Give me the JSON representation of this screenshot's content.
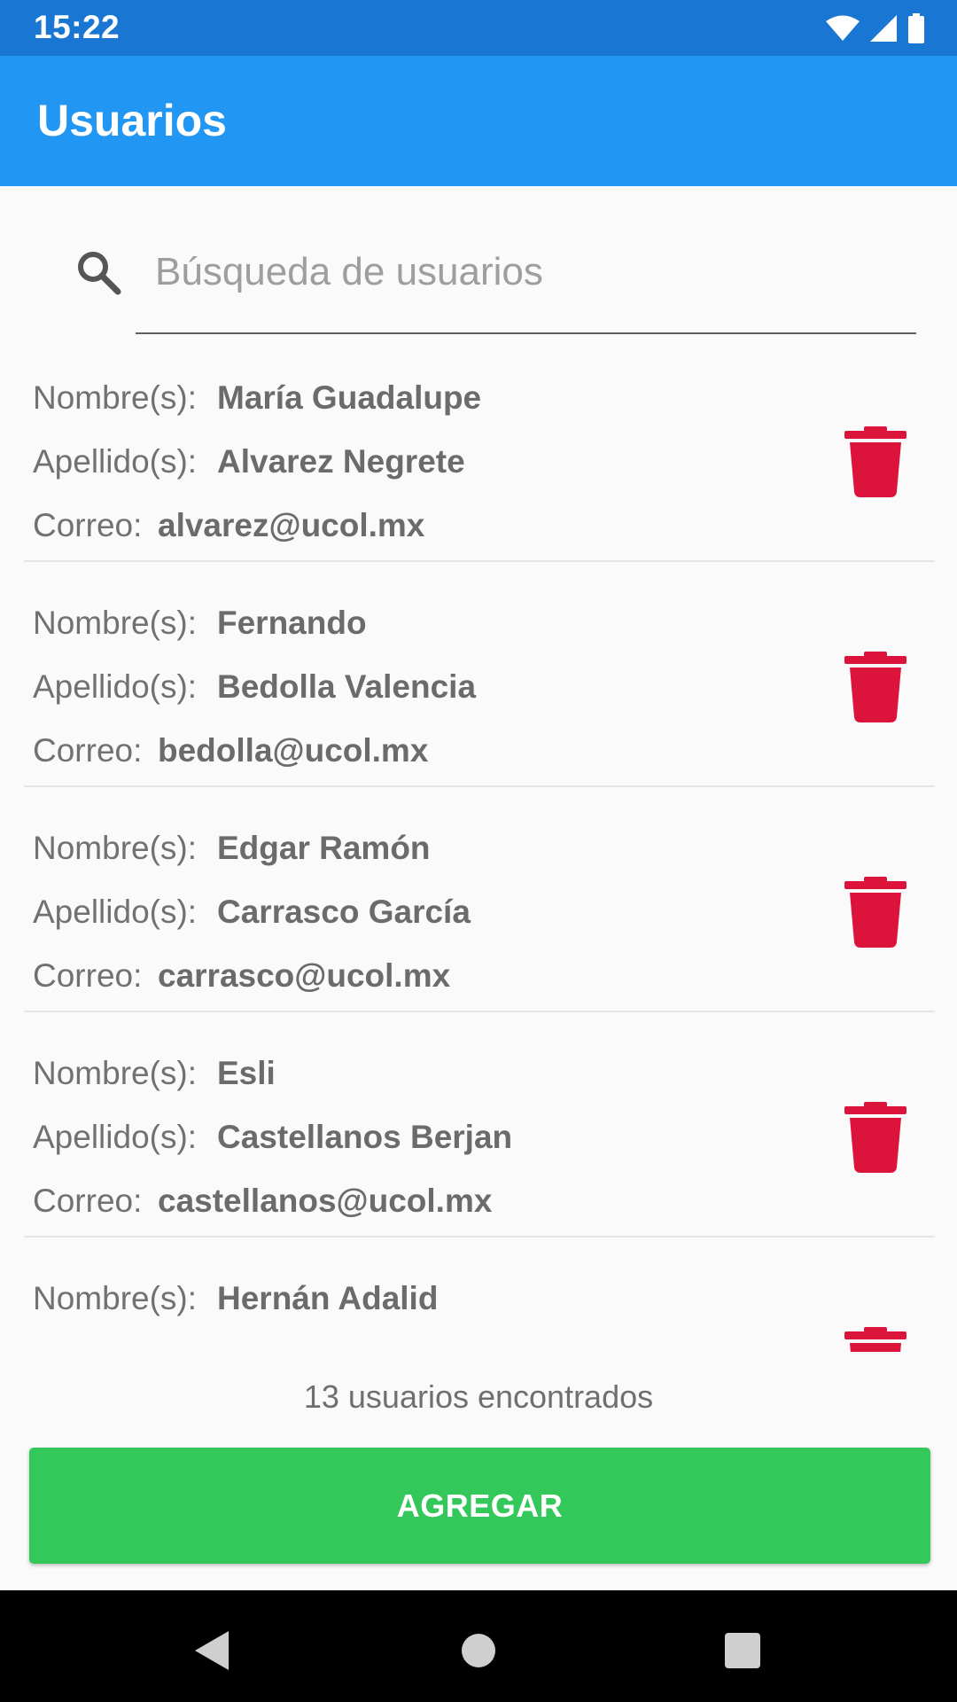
{
  "status_bar": {
    "time": "15:22"
  },
  "app_bar": {
    "title": "Usuarios"
  },
  "search": {
    "placeholder": "Búsqueda de usuarios",
    "value": ""
  },
  "labels": {
    "name": "Nombre(s):",
    "surname": "Apellido(s):",
    "email": "Correo:"
  },
  "users": [
    {
      "name": "María Guadalupe",
      "surname": "Alvarez Negrete",
      "email": "alvarez@ucol.mx"
    },
    {
      "name": "Fernando",
      "surname": "Bedolla Valencia",
      "email": "bedolla@ucol.mx"
    },
    {
      "name": "Edgar Ramón",
      "surname": "Carrasco García",
      "email": "carrasco@ucol.mx"
    },
    {
      "name": "Esli",
      "surname": "Castellanos Berjan",
      "email": "castellanos@ucol.mx"
    },
    {
      "name": "Hernán Adalid",
      "surname": "",
      "email": ""
    }
  ],
  "footer": {
    "results_text": "13 usuarios encontrados",
    "add_label": "AGREGAR"
  },
  "colors": {
    "status_bar": "#1976d2",
    "app_bar": "#2196f3",
    "delete": "#dc143c",
    "add_button": "#34c759",
    "nav_bar": "#000000"
  },
  "icons": {
    "search": "search-icon",
    "delete": "trash-icon",
    "nav_back": "triangle-back-icon",
    "nav_home": "circle-home-icon",
    "nav_recent": "square-recent-icon"
  }
}
